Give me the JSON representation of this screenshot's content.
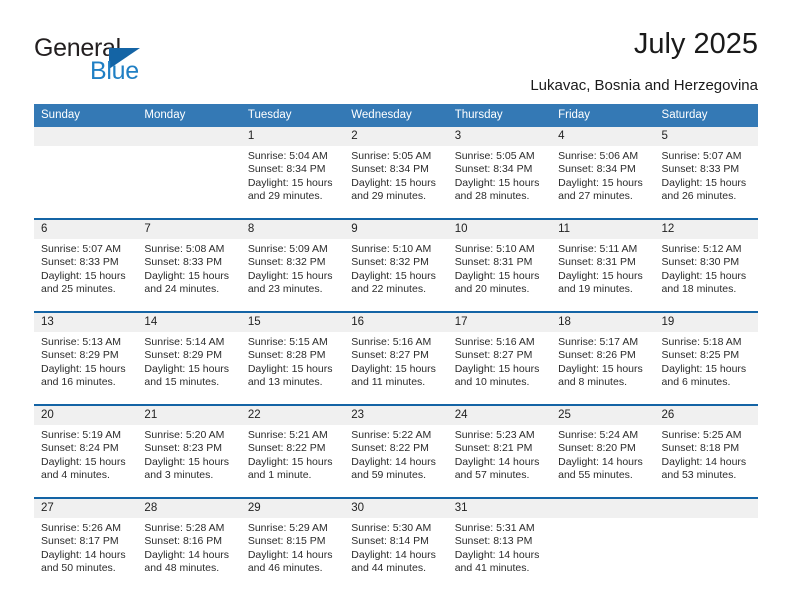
{
  "logo": {
    "word_one": "General",
    "word_two": "Blue",
    "triangle_color": "#1464a5",
    "blue_color": "#1f7fc4"
  },
  "header": {
    "month_title": "July 2025",
    "location": "Lukavac, Bosnia and Herzegovina"
  },
  "theme": {
    "header_bg": "#3479b5",
    "date_band_bg": "#f0f0f0",
    "row_divider": "#1464a5"
  },
  "calendar": {
    "weekday_headers": [
      "Sunday",
      "Monday",
      "Tuesday",
      "Wednesday",
      "Thursday",
      "Friday",
      "Saturday"
    ],
    "weeks": [
      [
        {
          "day": "",
          "lines": []
        },
        {
          "day": "",
          "lines": []
        },
        {
          "day": "1",
          "lines": [
            "Sunrise: 5:04 AM",
            "Sunset: 8:34 PM",
            "Daylight: 15 hours",
            "and 29 minutes."
          ]
        },
        {
          "day": "2",
          "lines": [
            "Sunrise: 5:05 AM",
            "Sunset: 8:34 PM",
            "Daylight: 15 hours",
            "and 29 minutes."
          ]
        },
        {
          "day": "3",
          "lines": [
            "Sunrise: 5:05 AM",
            "Sunset: 8:34 PM",
            "Daylight: 15 hours",
            "and 28 minutes."
          ]
        },
        {
          "day": "4",
          "lines": [
            "Sunrise: 5:06 AM",
            "Sunset: 8:34 PM",
            "Daylight: 15 hours",
            "and 27 minutes."
          ]
        },
        {
          "day": "5",
          "lines": [
            "Sunrise: 5:07 AM",
            "Sunset: 8:33 PM",
            "Daylight: 15 hours",
            "and 26 minutes."
          ]
        }
      ],
      [
        {
          "day": "6",
          "lines": [
            "Sunrise: 5:07 AM",
            "Sunset: 8:33 PM",
            "Daylight: 15 hours",
            "and 25 minutes."
          ]
        },
        {
          "day": "7",
          "lines": [
            "Sunrise: 5:08 AM",
            "Sunset: 8:33 PM",
            "Daylight: 15 hours",
            "and 24 minutes."
          ]
        },
        {
          "day": "8",
          "lines": [
            "Sunrise: 5:09 AM",
            "Sunset: 8:32 PM",
            "Daylight: 15 hours",
            "and 23 minutes."
          ]
        },
        {
          "day": "9",
          "lines": [
            "Sunrise: 5:10 AM",
            "Sunset: 8:32 PM",
            "Daylight: 15 hours",
            "and 22 minutes."
          ]
        },
        {
          "day": "10",
          "lines": [
            "Sunrise: 5:10 AM",
            "Sunset: 8:31 PM",
            "Daylight: 15 hours",
            "and 20 minutes."
          ]
        },
        {
          "day": "11",
          "lines": [
            "Sunrise: 5:11 AM",
            "Sunset: 8:31 PM",
            "Daylight: 15 hours",
            "and 19 minutes."
          ]
        },
        {
          "day": "12",
          "lines": [
            "Sunrise: 5:12 AM",
            "Sunset: 8:30 PM",
            "Daylight: 15 hours",
            "and 18 minutes."
          ]
        }
      ],
      [
        {
          "day": "13",
          "lines": [
            "Sunrise: 5:13 AM",
            "Sunset: 8:29 PM",
            "Daylight: 15 hours",
            "and 16 minutes."
          ]
        },
        {
          "day": "14",
          "lines": [
            "Sunrise: 5:14 AM",
            "Sunset: 8:29 PM",
            "Daylight: 15 hours",
            "and 15 minutes."
          ]
        },
        {
          "day": "15",
          "lines": [
            "Sunrise: 5:15 AM",
            "Sunset: 8:28 PM",
            "Daylight: 15 hours",
            "and 13 minutes."
          ]
        },
        {
          "day": "16",
          "lines": [
            "Sunrise: 5:16 AM",
            "Sunset: 8:27 PM",
            "Daylight: 15 hours",
            "and 11 minutes."
          ]
        },
        {
          "day": "17",
          "lines": [
            "Sunrise: 5:16 AM",
            "Sunset: 8:27 PM",
            "Daylight: 15 hours",
            "and 10 minutes."
          ]
        },
        {
          "day": "18",
          "lines": [
            "Sunrise: 5:17 AM",
            "Sunset: 8:26 PM",
            "Daylight: 15 hours",
            "and 8 minutes."
          ]
        },
        {
          "day": "19",
          "lines": [
            "Sunrise: 5:18 AM",
            "Sunset: 8:25 PM",
            "Daylight: 15 hours",
            "and 6 minutes."
          ]
        }
      ],
      [
        {
          "day": "20",
          "lines": [
            "Sunrise: 5:19 AM",
            "Sunset: 8:24 PM",
            "Daylight: 15 hours",
            "and 4 minutes."
          ]
        },
        {
          "day": "21",
          "lines": [
            "Sunrise: 5:20 AM",
            "Sunset: 8:23 PM",
            "Daylight: 15 hours",
            "and 3 minutes."
          ]
        },
        {
          "day": "22",
          "lines": [
            "Sunrise: 5:21 AM",
            "Sunset: 8:22 PM",
            "Daylight: 15 hours",
            "and 1 minute."
          ]
        },
        {
          "day": "23",
          "lines": [
            "Sunrise: 5:22 AM",
            "Sunset: 8:22 PM",
            "Daylight: 14 hours",
            "and 59 minutes."
          ]
        },
        {
          "day": "24",
          "lines": [
            "Sunrise: 5:23 AM",
            "Sunset: 8:21 PM",
            "Daylight: 14 hours",
            "and 57 minutes."
          ]
        },
        {
          "day": "25",
          "lines": [
            "Sunrise: 5:24 AM",
            "Sunset: 8:20 PM",
            "Daylight: 14 hours",
            "and 55 minutes."
          ]
        },
        {
          "day": "26",
          "lines": [
            "Sunrise: 5:25 AM",
            "Sunset: 8:18 PM",
            "Daylight: 14 hours",
            "and 53 minutes."
          ]
        }
      ],
      [
        {
          "day": "27",
          "lines": [
            "Sunrise: 5:26 AM",
            "Sunset: 8:17 PM",
            "Daylight: 14 hours",
            "and 50 minutes."
          ]
        },
        {
          "day": "28",
          "lines": [
            "Sunrise: 5:28 AM",
            "Sunset: 8:16 PM",
            "Daylight: 14 hours",
            "and 48 minutes."
          ]
        },
        {
          "day": "29",
          "lines": [
            "Sunrise: 5:29 AM",
            "Sunset: 8:15 PM",
            "Daylight: 14 hours",
            "and 46 minutes."
          ]
        },
        {
          "day": "30",
          "lines": [
            "Sunrise: 5:30 AM",
            "Sunset: 8:14 PM",
            "Daylight: 14 hours",
            "and 44 minutes."
          ]
        },
        {
          "day": "31",
          "lines": [
            "Sunrise: 5:31 AM",
            "Sunset: 8:13 PM",
            "Daylight: 14 hours",
            "and 41 minutes."
          ]
        },
        {
          "day": "",
          "lines": []
        },
        {
          "day": "",
          "lines": []
        }
      ]
    ]
  }
}
